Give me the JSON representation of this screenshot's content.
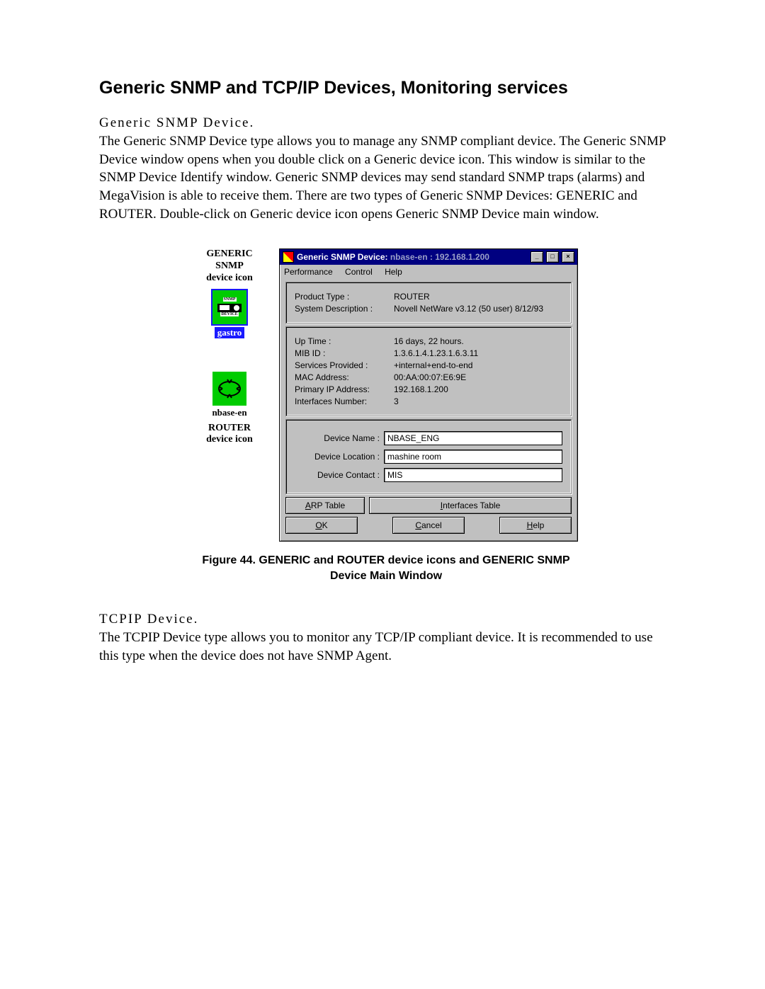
{
  "headings": {
    "main": "Generic SNMP and TCP/IP Devices, Monitoring services",
    "sec1": "Generic SNMP Device.",
    "sec2": "TCPIP Device."
  },
  "paragraphs": {
    "p1": "The Generic SNMP Device type allows you to manage any SNMP compliant device. The Generic SNMP Device window opens when you double click on a Generic device icon. This window is similar to the SNMP Device Identify window. Generic SNMP devices may send standard SNMP traps (alarms) and MegaVision is able to receive them. There are two types of Generic SNMP Devices: GENERIC and ROUTER. Double-click on Generic device icon opens Generic SNMP Device main window.",
    "p2": "The TCPIP Device type allows you to monitor any TCP/IP compliant device. It is recommended to use this type when the device does not have SNMP Agent."
  },
  "left_labels": {
    "snmp_label1": "GENERIC SNMP",
    "snmp_label2": "device icon",
    "snmp_caption": "gastro",
    "router_caption": "nbase-en",
    "router_label1": "ROUTER",
    "router_label2": "device icon"
  },
  "dialog": {
    "title_prefix": "Generic SNMP Device: ",
    "title_host": "nbase-en : 192.168.1.200",
    "menus": {
      "m1": "Performance",
      "m2": "Control",
      "m3": "Help"
    },
    "panel1": {
      "product_type_label": "Product Type :",
      "product_type": "ROUTER",
      "sys_desc_label": "System Description :",
      "sys_desc": "Novell NetWare v3.12 (50 user)  8/12/93"
    },
    "panel2": {
      "uptime_label": "Up Time :",
      "uptime": "16 days, 22 hours.",
      "mib_label": "MIB ID :",
      "mib": "1.3.6.1.4.1.23.1.6.3.11",
      "services_label": "Services Provided :",
      "services": "+internal+end-to-end",
      "mac_label": "MAC Address:",
      "mac": "00:AA:00:07:E6:9E",
      "pip_label": "Primary IP Address:",
      "pip": "192.168.1.200",
      "ifnum_label": "Interfaces Number:",
      "ifnum": "3"
    },
    "panel3": {
      "name_label": "Device Name :",
      "name": "NBASE_ENG",
      "loc_label": "Device Location :",
      "loc": "mashine room",
      "contact_label": "Device Contact :",
      "contact": "MIS"
    },
    "buttons": {
      "arp": "ARP Table",
      "if": "Interfaces Table",
      "ok": "OK",
      "cancel": "Cancel",
      "help": "Help"
    }
  },
  "figure_caption": "Figure 44. GENERIC and ROUTER device icons and GENERIC SNMP Device Main Window"
}
